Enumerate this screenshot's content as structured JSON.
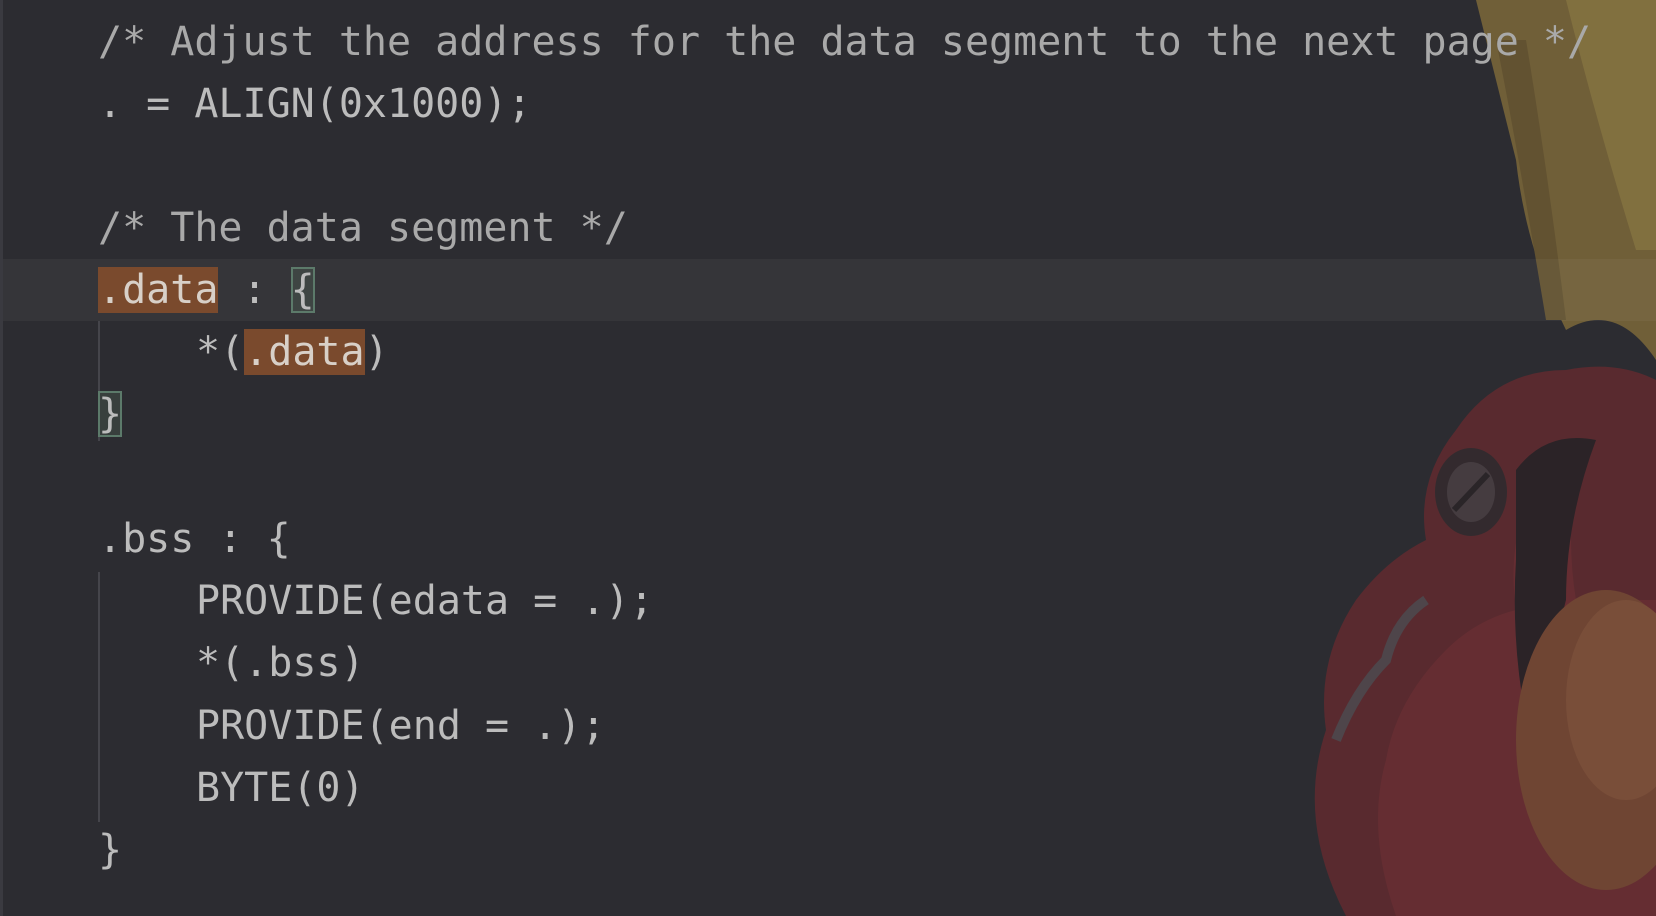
{
  "code": {
    "line1": "/* Adjust the address for the data segment to the next page */",
    "line2": ". = ALIGN(0x1000);",
    "line4": "/* The data segment */",
    "line5_kw": ".data",
    "line5_rest": " : ",
    "line5_brace": "{",
    "line6_pre": "*(",
    "line6_kw": ".data",
    "line6_post": ")",
    "line7_brace": "}",
    "line9": ".bss : {",
    "line10": "PROVIDE(edata = .);",
    "line11": "*(.bss)",
    "line12": "PROVIDE(end = .);",
    "line13": "BYTE(0)",
    "line14": "}"
  },
  "background": {
    "icon": "anime-character-background"
  },
  "colors": {
    "editor_bg": "#2c2c31",
    "text": "#bcbcbc",
    "search_highlight": "#7a4a2d"
  }
}
